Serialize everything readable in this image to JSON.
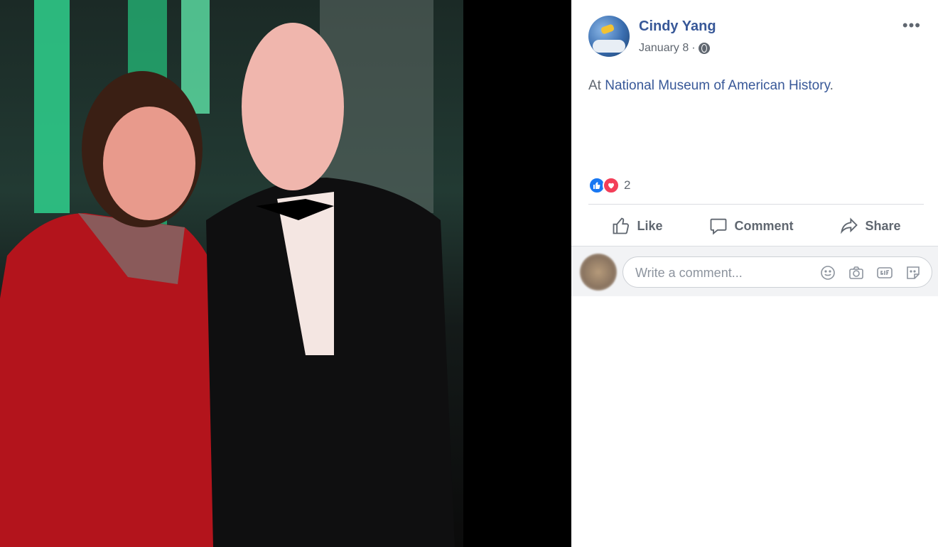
{
  "post": {
    "author": "Cindy Yang",
    "date": "January 8",
    "separator": "·",
    "text_prefix": "At ",
    "place": "National Museum of American History",
    "text_suffix": ".",
    "reaction_count": "2",
    "actions": {
      "like": "Like",
      "comment": "Comment",
      "share": "Share"
    },
    "comment_placeholder": "Write a comment...",
    "more": "•••"
  },
  "colors": {
    "link": "#385898",
    "muted": "#606770",
    "like": "#1877f2",
    "love": "#f33e58"
  },
  "icons": [
    "globe-icon",
    "more-icon",
    "like-reaction-icon",
    "love-reaction-icon",
    "like-icon",
    "comment-icon",
    "share-icon",
    "emoji-icon",
    "camera-icon",
    "gif-icon",
    "sticker-icon"
  ]
}
